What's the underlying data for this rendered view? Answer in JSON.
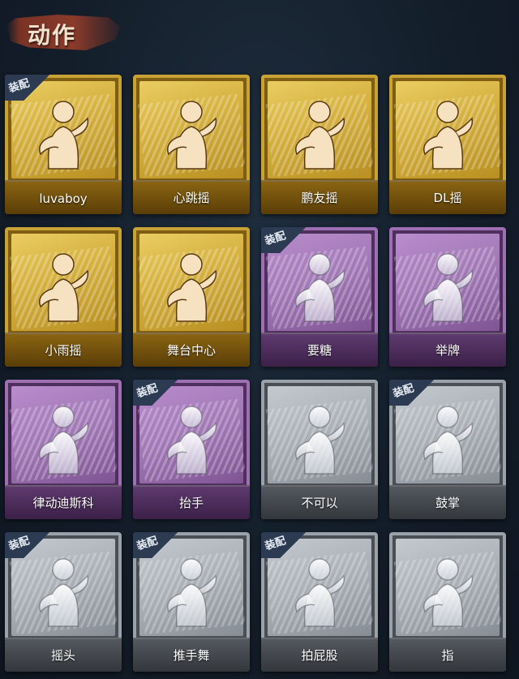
{
  "section": {
    "title": "动作"
  },
  "equipped_label": "装配",
  "colors": {
    "gold": "#d7b342",
    "purple": "#a178b6",
    "gray": "#a9afb5"
  },
  "cards": [
    {
      "label": "luvaboy",
      "rarity": "gold",
      "equipped": true,
      "icon": "dance-pose-icon"
    },
    {
      "label": "心跳摇",
      "rarity": "gold",
      "equipped": false,
      "icon": "dance-pose-icon"
    },
    {
      "label": "鹏友摇",
      "rarity": "gold",
      "equipped": false,
      "icon": "dance-pose-icon"
    },
    {
      "label": "DL摇",
      "rarity": "gold",
      "equipped": false,
      "icon": "dance-pose-icon"
    },
    {
      "label": "小雨摇",
      "rarity": "gold",
      "equipped": false,
      "icon": "dance-pose-icon"
    },
    {
      "label": "舞台中心",
      "rarity": "gold",
      "equipped": false,
      "icon": "dance-pose-icon"
    },
    {
      "label": "要糖",
      "rarity": "purple",
      "equipped": true,
      "icon": "hand-out-icon"
    },
    {
      "label": "举牌",
      "rarity": "purple",
      "equipped": false,
      "icon": "sign-hold-icon"
    },
    {
      "label": "律动迪斯科",
      "rarity": "purple",
      "equipped": false,
      "icon": "disco-pose-icon"
    },
    {
      "label": "抬手",
      "rarity": "purple",
      "equipped": true,
      "icon": "raise-hand-icon"
    },
    {
      "label": "不可以",
      "rarity": "gray",
      "equipped": false,
      "icon": "finger-wag-icon"
    },
    {
      "label": "鼓掌",
      "rarity": "gray",
      "equipped": true,
      "icon": "clap-icon"
    },
    {
      "label": "摇头",
      "rarity": "gray",
      "equipped": true,
      "icon": "head-shake-icon"
    },
    {
      "label": "推手舞",
      "rarity": "gray",
      "equipped": true,
      "icon": "push-dance-icon"
    },
    {
      "label": "拍屁股",
      "rarity": "gray",
      "equipped": true,
      "icon": "butt-pat-icon"
    },
    {
      "label": "指",
      "rarity": "gray",
      "equipped": false,
      "icon": "point-icon"
    }
  ]
}
